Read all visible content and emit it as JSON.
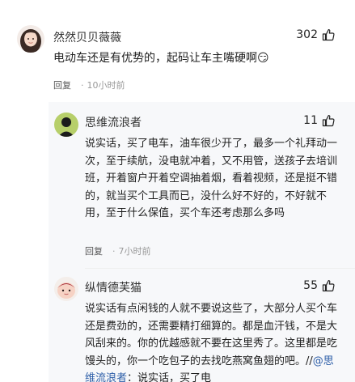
{
  "comments": [
    {
      "user": "然然贝贝薇薇",
      "likes": "302",
      "text": "电动车还是有优势的，起码让车主嘴硬啊😏",
      "reply_label": "回复",
      "time": "10小时前"
    }
  ],
  "replies": [
    {
      "user": "思维流浪者",
      "likes": "11",
      "text": "说实话，买了电车，油车很少开了，最多一个礼拜动一次，至于续航，没电就冲着，又不用管，送孩子去培训班，开着窗户开着空调抽着烟，看着视频，还是挺不错的，就当买个工具而已，没什么好不好的，不好就不用，至于什么保值，买个车还考虑那么多吗",
      "reply_label": "回复",
      "time": "7小时前"
    },
    {
      "user": "纵情德芙猫",
      "likes": "55",
      "text": "说实话有点闲钱的人就不要说这些了，大部分人买个车还是费劲的，还需要精打细算的。都是血汗钱，不是大风刮来的。你的优越感就不要在这里秀了。这里都是吃馒头的，你一个吃包子的去找吃燕窝鱼翅的吧。//",
      "mention": "@思维流浪者",
      "text_tail": "：说实话，买了电"
    }
  ],
  "icons": {
    "like": "thumbs-up-icon"
  },
  "colors": {
    "mention": "#2d5ea8",
    "muted": "#999999"
  }
}
